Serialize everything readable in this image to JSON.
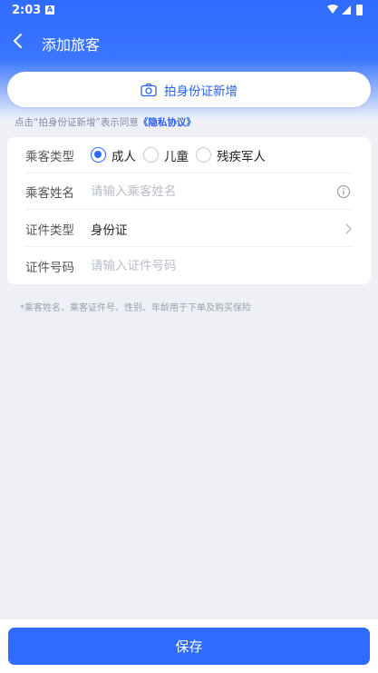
{
  "status_bar": {
    "time": "2:03",
    "notification_badge": "A"
  },
  "header": {
    "title": "添加旅客"
  },
  "scan": {
    "label": "拍身份证新增",
    "icon": "camera-icon"
  },
  "consent": {
    "prefix": "点击“拍身份证新增”表示同意",
    "link": "《隐私协议》"
  },
  "form": {
    "type_row": {
      "label": "乘客类型",
      "options": [
        {
          "label": "成人",
          "selected": true
        },
        {
          "label": "儿童",
          "selected": false
        },
        {
          "label": "残疾军人",
          "selected": false
        }
      ]
    },
    "name_row": {
      "label": "乘客姓名",
      "placeholder": "请输入乘客姓名",
      "value": ""
    },
    "doc_type_row": {
      "label": "证件类型",
      "value": "身份证"
    },
    "doc_number_row": {
      "label": "证件号码",
      "placeholder": "请输入证件号码",
      "value": ""
    }
  },
  "note": "*乘客姓名、乘客证件号、性别、年龄用于下单及购买保险",
  "footer": {
    "save_label": "保存"
  },
  "colors": {
    "primary": "#2f6bff",
    "background": "#eef0f5"
  }
}
